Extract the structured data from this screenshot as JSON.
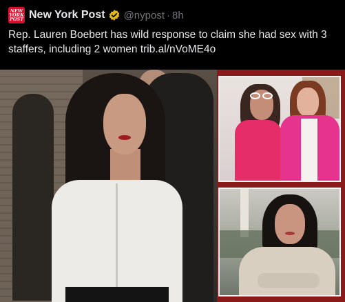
{
  "tweet": {
    "account": {
      "display_name": "New York Post",
      "handle": "@nypost",
      "separator": "·",
      "time": "8h",
      "avatar_text": [
        "NEW",
        "YORK",
        "POST"
      ],
      "verified_badge_color": "#e2b719",
      "avatar_color": "#d3102e"
    },
    "text": "Rep. Lauren Boebert has wild response to claim she had sex with 3 staffers, including 2 women trib.al/nVoME4o",
    "media": {
      "main_photo": "woman-in-white-shirt-photo",
      "top_right_photo": "two-women-in-pink-photo",
      "bottom_right_photo": "woman-portrait-outdoors-photo",
      "collage_border_color": "#8a1a1a"
    }
  }
}
